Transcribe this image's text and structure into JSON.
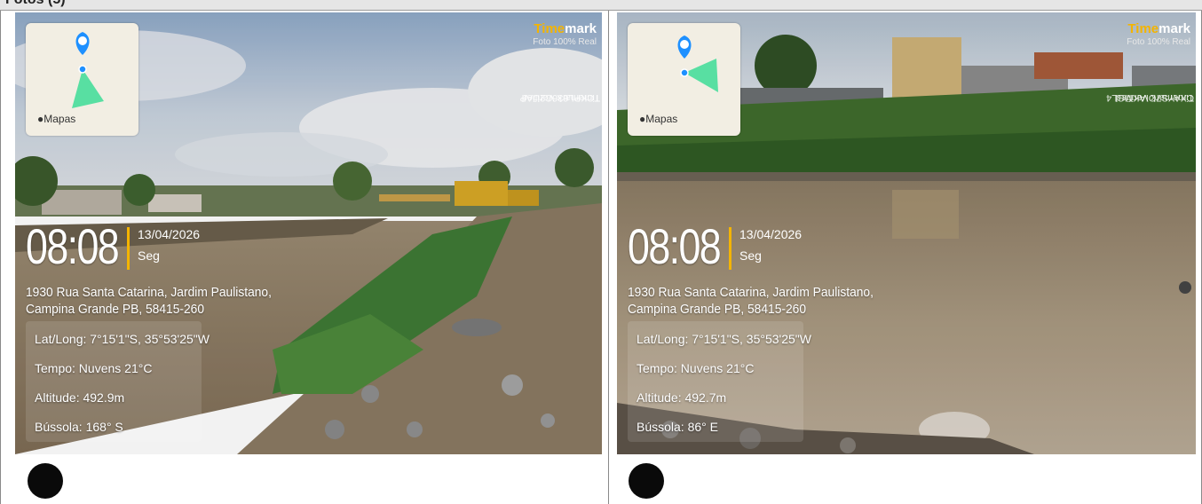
{
  "header": {
    "title": "Fotos (5)"
  },
  "photos": [
    {
      "map_label": "Mapas",
      "brand_part1": "Time",
      "brand_part2": "mark",
      "brand_subtitle": "Foto 100% Real",
      "verified_text": "Timemark Verified",
      "code_text": "TCKPL636C2UAP",
      "time": "08:08",
      "date": "13/04/2026",
      "day": "Seg",
      "address_line1": "1930 Rua Santa Catarina, Jardim Paulistano,",
      "address_line2": "Campina Grande PB, 58415-260",
      "lat_long": "Lat/Long: 7°15'1\"S, 35°53'25\"W",
      "weather": "Tempo: Nuvens 21°C",
      "altitude": "Altitude: 492.9m",
      "compass": "Bússola: 168° S"
    },
    {
      "map_label": "Mapas",
      "brand_part1": "Time",
      "brand_part2": "mark",
      "brand_subtitle": "Foto 100% Real",
      "verified_text": "Timemark Verified",
      "code_text": "CXAYS7OIAKMGL4",
      "time": "08:08",
      "date": "13/04/2026",
      "day": "Seg",
      "address_line1": "1930 Rua Santa Catarina, Jardim Paulistano,",
      "address_line2": "Campina Grande PB, 58415-260",
      "lat_long": "Lat/Long: 7°15'1\"S, 35°53'25\"W",
      "weather": "Tempo: Nuvens 21°C",
      "altitude": "Altitude: 492.7m",
      "compass": "Bússola: 86° E"
    }
  ],
  "colors": {
    "accent": "#f4b400",
    "pin": "#1e90ff",
    "cone": "#3ddc97"
  }
}
